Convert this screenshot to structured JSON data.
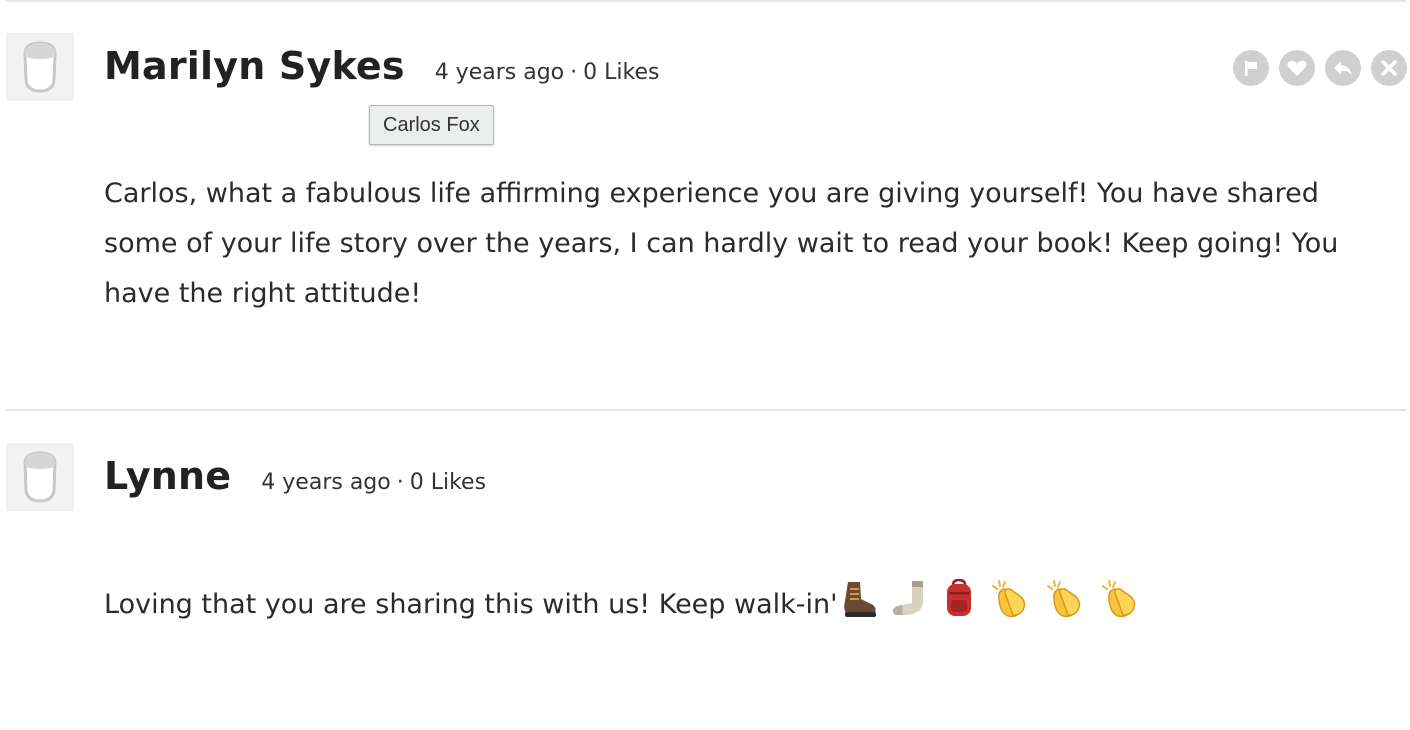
{
  "comments": [
    {
      "author": "Marilyn Sykes",
      "time": "4 years ago",
      "separator": "·",
      "likes": "0 Likes",
      "text": "Carlos, what a fabulous life affirming experience you are giving yourself! You have shared some of your life story over the years, I can hardly wait to read your book! Keep going! You have the right attitude!",
      "actions": [
        "flag-icon",
        "heart-icon",
        "reply-icon",
        "close-icon"
      ]
    },
    {
      "author": "Lynne",
      "time": "4 years ago",
      "separator": "·",
      "likes": "0 Likes",
      "text": "Loving that you are sharing this with us! Keep walk-in'",
      "emojis": [
        "hiking-boot-icon",
        "sock-icon",
        "backpack-icon",
        "clapping-hands-icon",
        "clapping-hands-icon",
        "clapping-hands-icon"
      ]
    }
  ],
  "tooltip": "Carlos Fox",
  "colors": {
    "icon_bg": "#d0d0d0",
    "divider": "#e6e6e6",
    "avatar_bg": "#f2f2f2"
  }
}
